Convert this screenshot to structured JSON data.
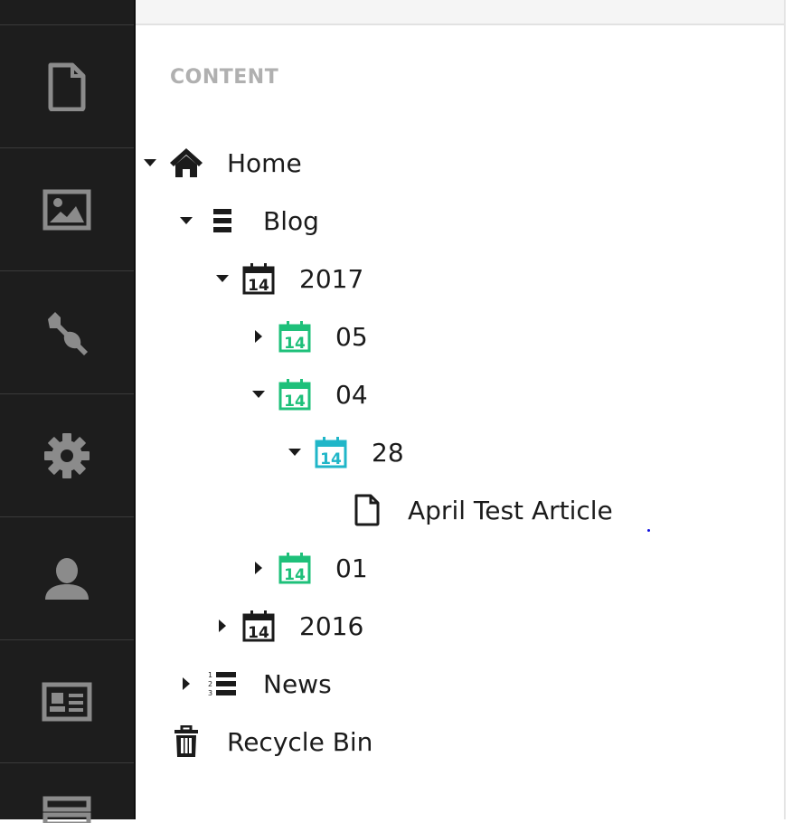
{
  "colors": {
    "sidebar_bg": "#1d1d1d",
    "sidebar_icon": "#8b8b8b",
    "calendar_green": "#1ec07a",
    "calendar_cyan": "#20b6c8",
    "text": "#1b1b1b"
  },
  "sidebar": {
    "items": [
      {
        "icon": "document-icon",
        "name": "section-content"
      },
      {
        "icon": "image-icon",
        "name": "section-media"
      },
      {
        "icon": "wrench-icon",
        "name": "section-settings"
      },
      {
        "icon": "gear-icon",
        "name": "section-developer"
      },
      {
        "icon": "user-icon",
        "name": "section-users"
      },
      {
        "icon": "id-card-icon",
        "name": "section-members"
      },
      {
        "icon": "form-icon",
        "name": "section-forms"
      }
    ]
  },
  "panel": {
    "title": "CONTENT"
  },
  "tree": {
    "home": {
      "label": "Home",
      "icon": "home-icon",
      "expanded": true
    },
    "blog": {
      "label": "Blog",
      "icon": "list-icon",
      "expanded": true
    },
    "y2017": {
      "label": "2017",
      "icon": "calendar-icon",
      "expanded": true
    },
    "m05": {
      "label": "05",
      "icon": "calendar-icon",
      "expanded": false
    },
    "m04": {
      "label": "04",
      "icon": "calendar-icon",
      "expanded": true
    },
    "d28": {
      "label": "28",
      "icon": "calendar-icon",
      "expanded": true
    },
    "article": {
      "label": "April Test Article",
      "icon": "document-icon"
    },
    "m01": {
      "label": "01",
      "icon": "calendar-icon",
      "expanded": false
    },
    "y2016": {
      "label": "2016",
      "icon": "calendar-icon",
      "expanded": false
    },
    "news": {
      "label": "News",
      "icon": "numbered-list-icon",
      "expanded": false
    },
    "recycle": {
      "label": "Recycle Bin",
      "icon": "trash-icon"
    }
  },
  "calendar_day": "14"
}
